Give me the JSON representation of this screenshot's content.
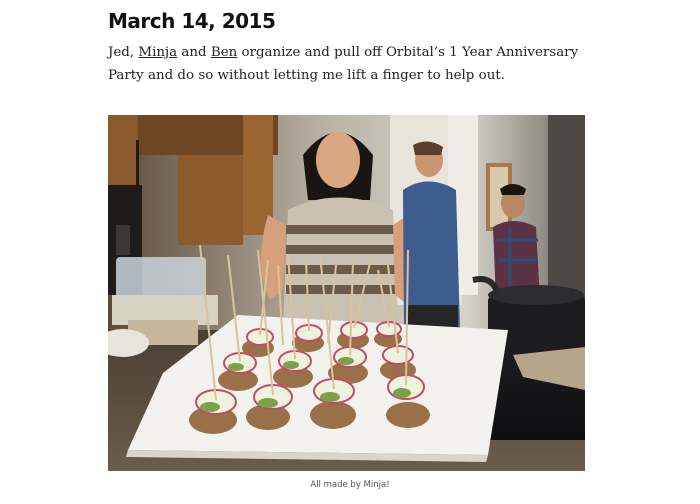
{
  "post": {
    "date": "March 14, 2015",
    "text_before": "Jed, ",
    "link_minja": "Minja",
    "text_middle": " and ",
    "link_ben": "Ben",
    "text_after": " organize and pull off Orbital’s 1 Year Anniversary Party and do so without letting me lift a finger to help out."
  },
  "photo": {
    "caption": "All made by Minja!"
  }
}
